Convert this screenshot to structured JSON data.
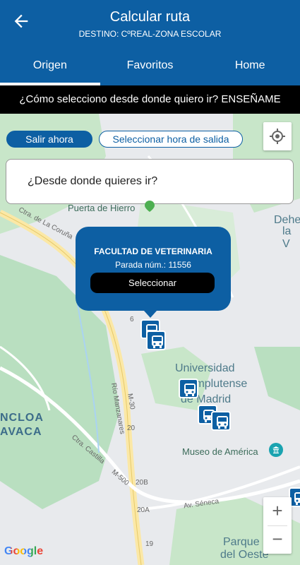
{
  "header": {
    "title": "Calcular ruta",
    "subtitle": "DESTINO: CºREAL-ZONA ESCOLAR",
    "tabs": [
      {
        "label": "Origen",
        "active": true
      },
      {
        "label": "Favoritos",
        "active": false
      },
      {
        "label": "Home",
        "active": false
      }
    ]
  },
  "help_bar": "¿Cómo selecciono desde donde quiero ir? ENSEÑAME",
  "departure": {
    "now_label": "Salir ahora",
    "pick_time_label": "Seleccionar hora de salida"
  },
  "search": {
    "placeholder": "¿Desde donde quieres ir?"
  },
  "popup": {
    "stop_name": "FACULTAD DE VETERINARIA",
    "stop_number": "Parada núm.: 11556",
    "select_label": "Seleccionar"
  },
  "map": {
    "labels": {
      "puerta_hierro": "Puerta de Hierro",
      "dehesa": "Dehes",
      "dehesa2": "la V",
      "coruna": "Ctra. de La Coruña",
      "universidad1": "Universidad",
      "universidad2": "Complutense",
      "universidad3": "de Madrid",
      "museo": "Museo de América",
      "moncloa1": "NCLOA",
      "moncloa2": "AVACA",
      "castilla": "Ctra. Castilla",
      "manzanares": "Río Manzanares",
      "seneca": "Av. Séneca",
      "parque1": "Parque",
      "parque2": "del Oeste",
      "m500": "M-500",
      "m30": "M-30",
      "exit6": "6",
      "exit20": "20",
      "exit20b": "20B",
      "exit20a": "20A",
      "exit19": "19"
    },
    "zoom_in": "+",
    "zoom_out": "−",
    "attribution": "Google"
  },
  "colors": {
    "primary": "#0d5fa3",
    "help_bar": "#000000",
    "map_park": "#b9dfc0",
    "map_road": "#fbe8a6"
  }
}
